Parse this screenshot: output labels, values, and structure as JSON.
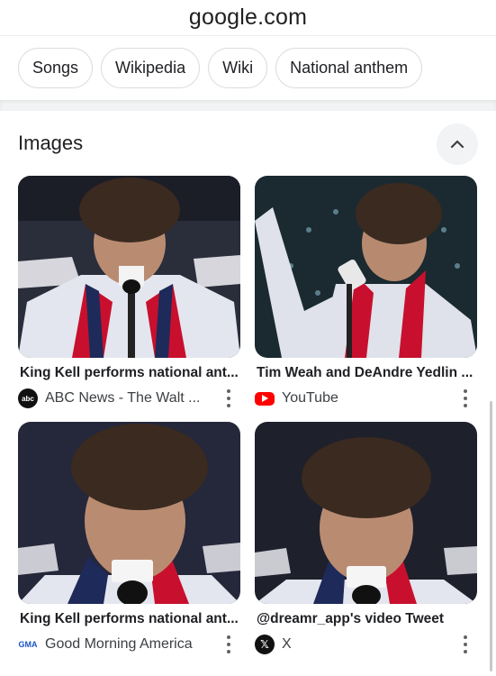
{
  "browser": {
    "url": "google.com"
  },
  "chips": [
    "Songs",
    "Wikipedia",
    "Wiki",
    "National anthem"
  ],
  "images_section": {
    "title": "Images"
  },
  "results": [
    {
      "caption": "King Kell performs national ant...",
      "source": "ABC News - The Walt ...",
      "source_icon": "abc-logo-icon",
      "icon_label": "abc"
    },
    {
      "caption": "Tim Weah and DeAndre Yedlin ...",
      "source": "YouTube",
      "source_icon": "youtube-icon",
      "icon_label": ""
    },
    {
      "caption": "King Kell performs national ant...",
      "source": "Good Morning America",
      "source_icon": "gma-logo-icon",
      "icon_label": "GMA"
    },
    {
      "caption": "@dreamr_app's video Tweet",
      "source": "X",
      "source_icon": "x-logo-icon",
      "icon_label": "𝕏"
    }
  ],
  "colors": {
    "youtube_red": "#ff0000",
    "gma_blue": "#1a55c5",
    "chip_border": "#dadce0"
  }
}
